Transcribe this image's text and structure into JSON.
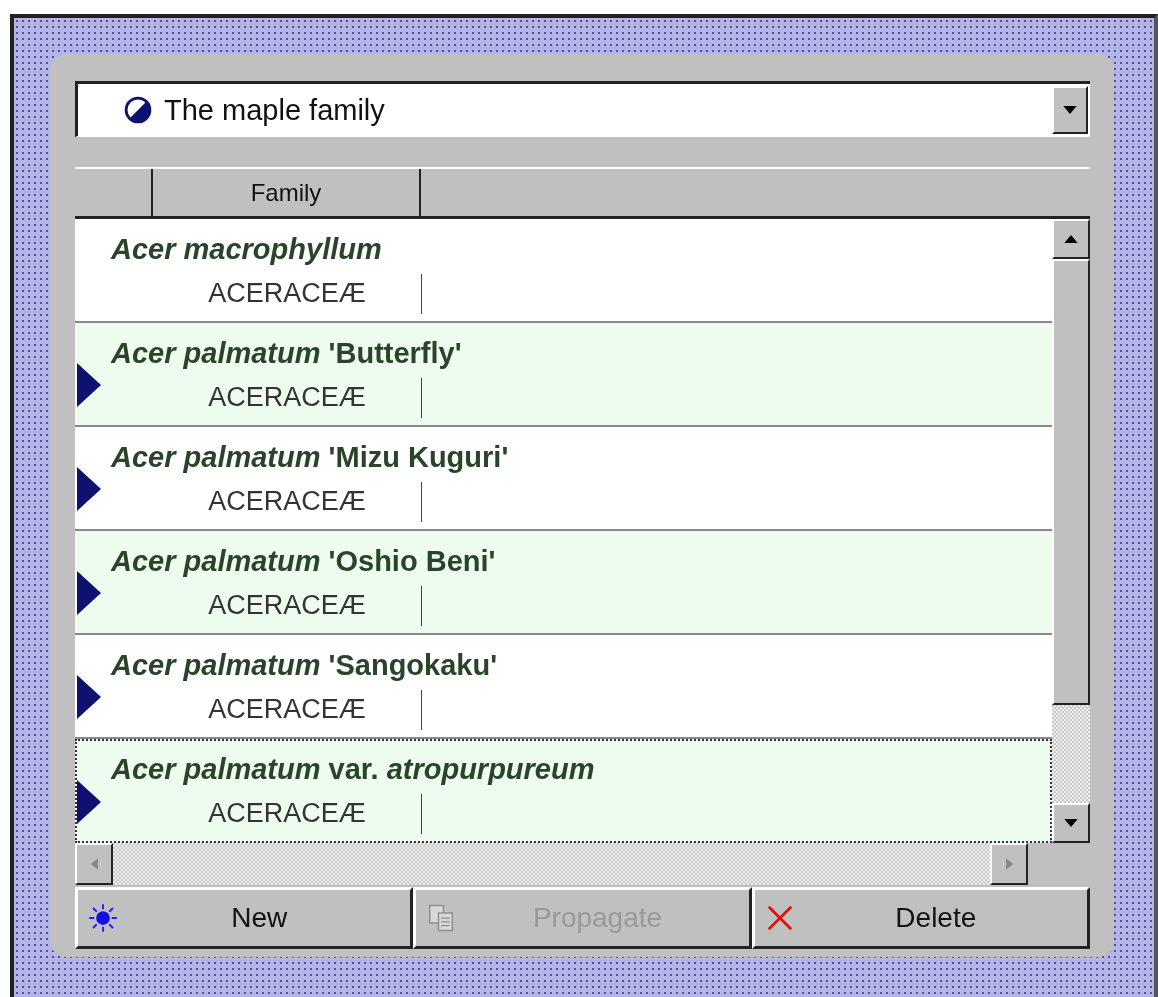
{
  "combo": {
    "value": "The maple family"
  },
  "table": {
    "columns": [
      "Family"
    ],
    "rows": [
      {
        "name": "*Acer macrophyllum*",
        "family": "ACERACEÆ",
        "marked": false,
        "focused": false
      },
      {
        "name": "*Acer palmatum* 'Butterfly'",
        "family": "ACERACEÆ",
        "marked": true,
        "focused": false
      },
      {
        "name": "*Acer palmatum* 'Mizu Kuguri'",
        "family": "ACERACEÆ",
        "marked": true,
        "focused": false
      },
      {
        "name": "*Acer palmatum* 'Oshio Beni'",
        "family": "ACERACEÆ",
        "marked": true,
        "focused": false
      },
      {
        "name": "*Acer palmatum* 'Sangokaku'",
        "family": "ACERACEÆ",
        "marked": true,
        "focused": false
      },
      {
        "name": "*Acer palmatum* var. *atropurpureum*",
        "family": "ACERACEÆ",
        "marked": true,
        "focused": true
      }
    ]
  },
  "buttons": [
    {
      "label": "New",
      "kind": "new",
      "disabled": false
    },
    {
      "label": "Propagate",
      "kind": "copy",
      "disabled": true
    },
    {
      "label": "Delete",
      "kind": "delete",
      "disabled": false
    }
  ]
}
